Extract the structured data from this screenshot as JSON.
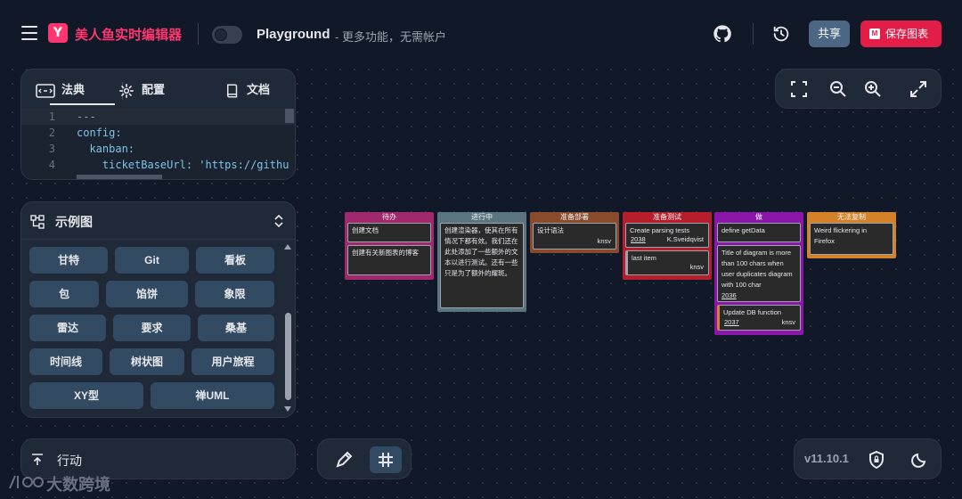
{
  "header": {
    "brand": "美人鱼实时编辑器",
    "playground_title": "Playground",
    "playground_subtitle": "- 更多功能，无需帐户",
    "share_label": "共享",
    "save_label": "保存图表",
    "icons": [
      "menu-icon",
      "mermaid-logo-icon",
      "github-icon",
      "history-icon"
    ]
  },
  "editor": {
    "tabs": [
      {
        "label": "法典",
        "icon": "code-icon"
      },
      {
        "label": "配置",
        "icon": "gear-icon"
      },
      {
        "label": "文档",
        "icon": "book-icon"
      }
    ],
    "lines": [
      {
        "num": "1",
        "text": "---"
      },
      {
        "num": "2",
        "text": "config:"
      },
      {
        "num": "3",
        "text": "  kanban:"
      },
      {
        "num": "4",
        "text": "    ticketBaseUrl: 'https://githu"
      }
    ]
  },
  "examples": {
    "title": "示例图",
    "items": [
      "甘特",
      "Git",
      "看板",
      "包",
      "馅饼",
      "象限",
      "雷达",
      "要求",
      "桑基",
      "时间线",
      "树状图",
      "用户旅程",
      "XY型",
      "禅UML"
    ]
  },
  "actions": {
    "label": "行动"
  },
  "version": {
    "label": "v11.10.1"
  },
  "watermark": {
    "text": "大数跨境"
  },
  "kanban": {
    "columns": [
      {
        "title": "待办",
        "color": "#a0286c",
        "cards": [
          {
            "text": "创建文档"
          },
          {
            "text": "创建有关新图表的博客"
          }
        ]
      },
      {
        "title": "进行中",
        "color": "#5a7480",
        "cards": [
          {
            "text": "创建渲染器，使其在所有情况下都有效。我们还在此处添加了一些额外的文本以进行测试。还有一些只是为了额外的耀斑。"
          }
        ]
      },
      {
        "title": "准备部署",
        "color": "#8a4a2c",
        "cards": [
          {
            "text": "设计语法",
            "assigned": "knsv"
          }
        ]
      },
      {
        "title": "准备测试",
        "color": "#b51e2a",
        "cards": [
          {
            "text": "Create parsing tests",
            "ticket": "2038",
            "assigned": "K.Sveidqvist"
          },
          {
            "text": "last item",
            "assigned": "knsv"
          }
        ]
      },
      {
        "title": "做",
        "color": "#8a17a8",
        "cards": [
          {
            "text": "define getData"
          },
          {
            "text": "Title of diagram is more than 100 chars when user duplicates diagram with 100 char",
            "ticket": "2036"
          },
          {
            "text": "Update DB function",
            "ticket": "2037",
            "assigned": "knsv"
          }
        ]
      },
      {
        "title": "无法复制",
        "color": "#d4822a",
        "cards": [
          {
            "text": "Weird flickering in Firefox"
          }
        ]
      }
    ]
  },
  "colors": {
    "accent": "#ff3670",
    "save": "#e11d48",
    "share": "#4b6783",
    "panel": "#1f2937",
    "background": "#111827"
  }
}
